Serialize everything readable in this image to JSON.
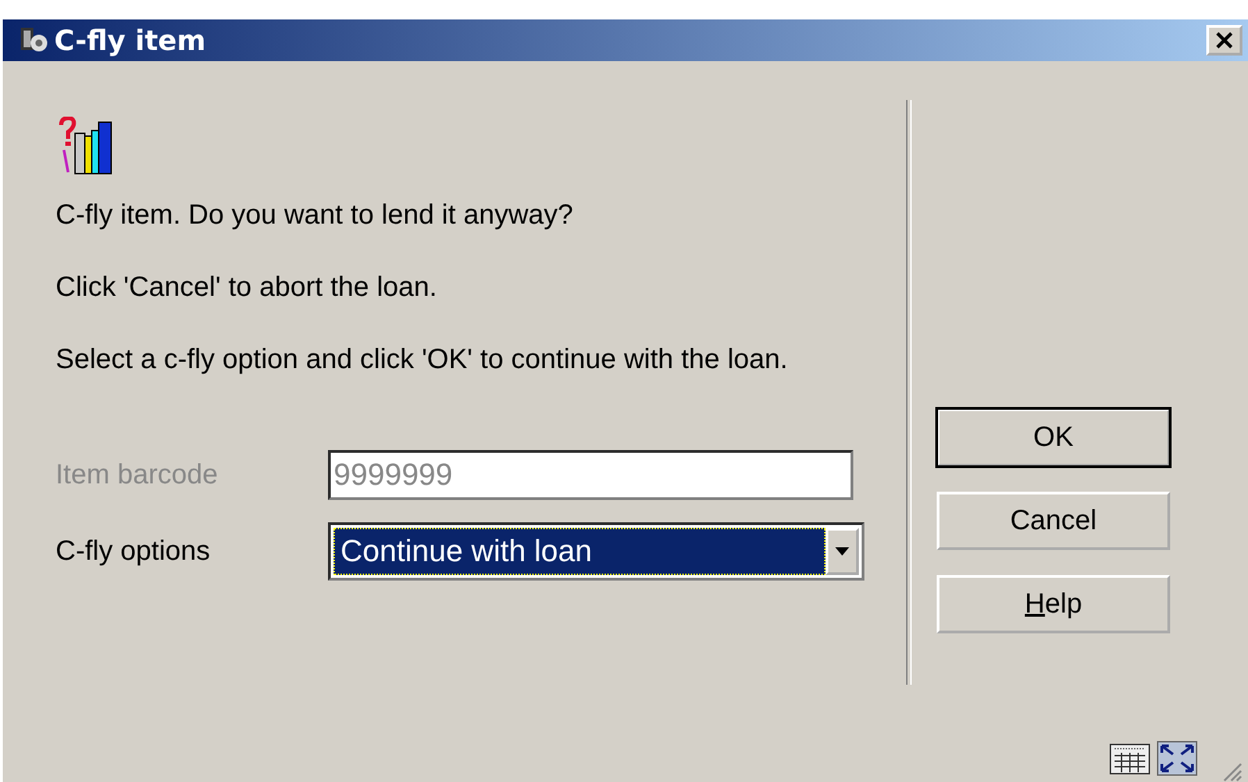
{
  "window": {
    "title": "C-fly item"
  },
  "messages": [
    "C-fly item. Do you want to lend it anyway?",
    "Click 'Cancel' to abort the loan.",
    "Select a c-fly option and click 'OK' to continue with the loan."
  ],
  "fields": [
    {
      "kind": "text",
      "label": "Item barcode",
      "value": "9999999",
      "disabled": true
    },
    {
      "kind": "dropdown",
      "label": "C-fly options",
      "value": "Continue with loan",
      "disabled": false
    }
  ],
  "buttons": [
    {
      "label": "OK",
      "default": true,
      "mnemonic_first": false
    },
    {
      "label": "Cancel",
      "default": false,
      "mnemonic_first": false
    },
    {
      "label": "Help",
      "default": false,
      "mnemonic_first": true
    }
  ]
}
